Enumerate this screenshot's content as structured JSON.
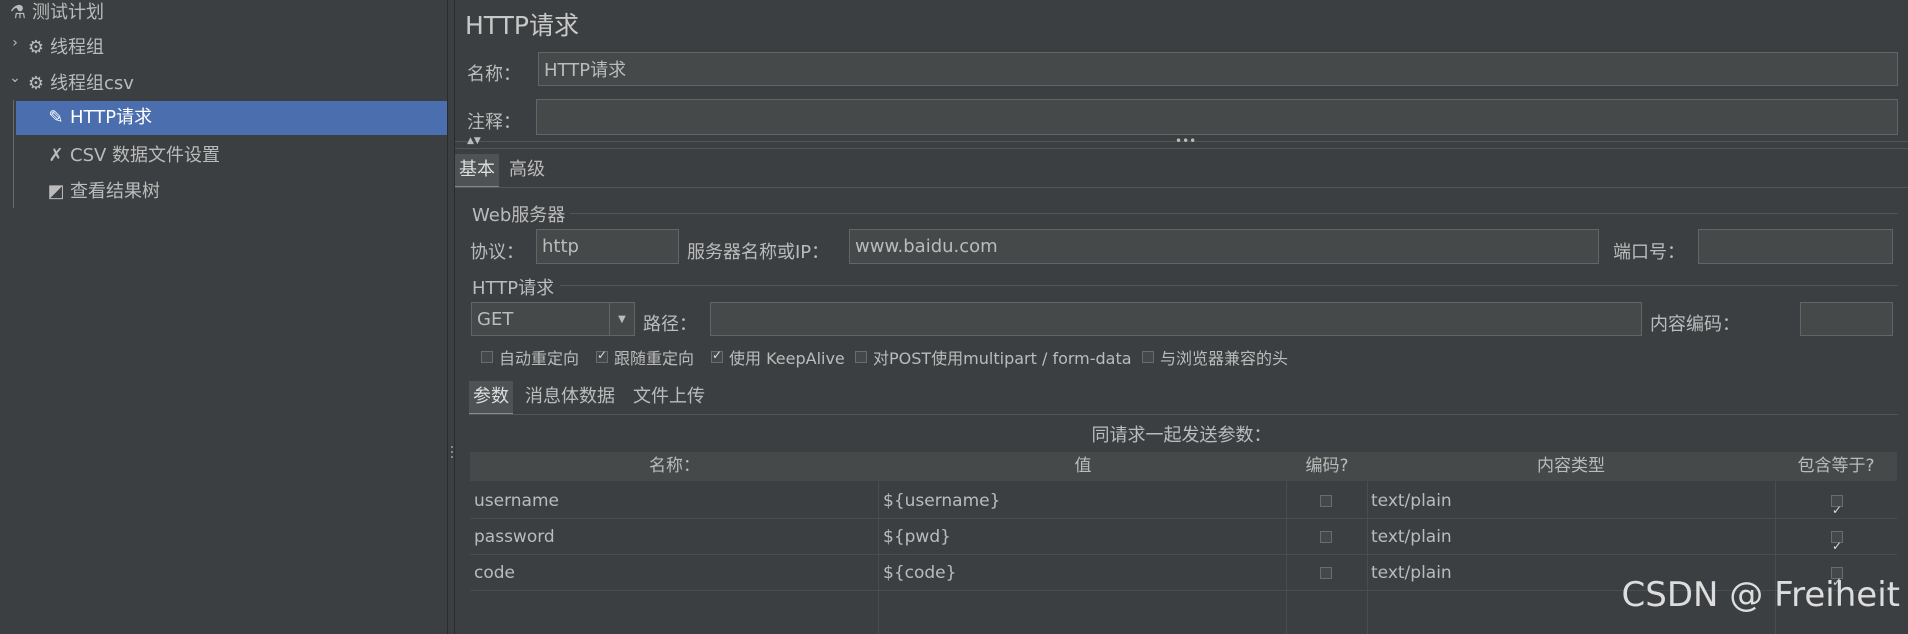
{
  "tree": {
    "items": [
      {
        "label": "测试计划",
        "icon": "flask-icon"
      },
      {
        "label": "线程组",
        "icon": "gear-icon"
      },
      {
        "label": "线程组csv",
        "icon": "gear-icon"
      },
      {
        "label": "HTTP请求",
        "icon": "pen-icon"
      },
      {
        "label": "CSV 数据文件设置",
        "icon": "tools-icon"
      },
      {
        "label": "查看结果树",
        "icon": "chart-icon"
      }
    ]
  },
  "panel": {
    "title": "HTTP请求",
    "name_label": "名称：",
    "name_value": "HTTP请求",
    "comment_label": "注释：",
    "comment_value": "",
    "tabs": [
      "基本",
      "高级"
    ],
    "web_server": {
      "section": "Web服务器",
      "protocol_label": "协议：",
      "protocol_value": "http",
      "server_label": "服务器名称或IP：",
      "server_value": "www.baidu.com",
      "port_label": "端口号：",
      "port_value": ""
    },
    "http_request": {
      "section": "HTTP请求",
      "method": "GET",
      "path_label": "路径：",
      "path_value": "",
      "encoding_label": "内容编码：",
      "encoding_value": ""
    },
    "checkboxes": [
      {
        "label": "自动重定向",
        "checked": false
      },
      {
        "label": "跟随重定向",
        "checked": true
      },
      {
        "label": "使用 KeepAlive",
        "checked": true
      },
      {
        "label": "对POST使用multipart / form-data",
        "checked": false
      },
      {
        "label": "与浏览器兼容的头",
        "checked": false
      }
    ],
    "sub_tabs": [
      "参数",
      "消息体数据",
      "文件上传"
    ],
    "params_caption": "同请求一起发送参数：",
    "table": {
      "headers": [
        "名称：",
        "值",
        "编码?",
        "内容类型",
        "包含等于?"
      ],
      "rows": [
        {
          "name": "username",
          "value": "${username}",
          "encode": false,
          "content_type": "text/plain",
          "include_equals": true
        },
        {
          "name": "password",
          "value": "${pwd}",
          "encode": false,
          "content_type": "text/plain",
          "include_equals": true
        },
        {
          "name": "code",
          "value": "${code}",
          "encode": false,
          "content_type": "text/plain",
          "include_equals": true
        }
      ]
    }
  },
  "watermark": "CSDN @ Freiheit"
}
